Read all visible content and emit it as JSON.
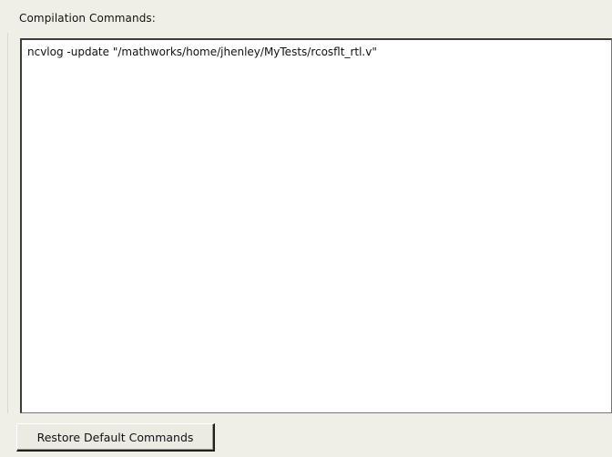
{
  "compilation": {
    "label": "Compilation Commands:",
    "commands_text": "ncvlog -update \"/mathworks/home/jhenley/MyTests/rcosflt_rtl.v\""
  },
  "actions": {
    "restore_label": "Restore Default Commands"
  }
}
